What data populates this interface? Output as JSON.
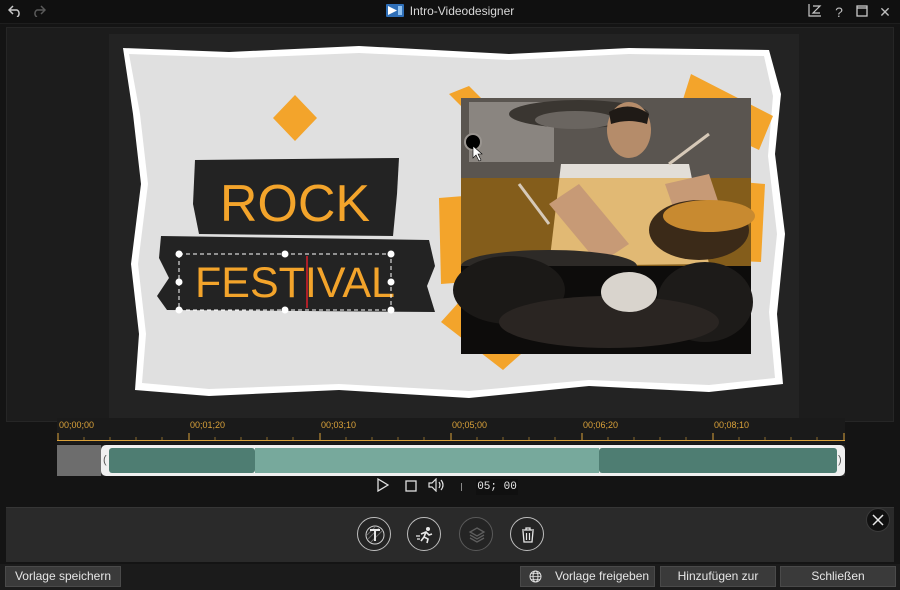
{
  "window": {
    "title": "Intro-Videodesigner",
    "undo_icon": "undo-icon",
    "redo_icon": "redo-icon",
    "controls": [
      "resize-icon",
      "help-icon",
      "maximize-icon",
      "close-icon"
    ],
    "help_glyph": "?",
    "close_glyph": "✕"
  },
  "canvas": {
    "title_line1": "ROCK",
    "title_line2": "FESTIVAL",
    "colors": {
      "accent": "#f3a42b",
      "paper": "#e0e0e0",
      "band": "#232323",
      "photo_tint": "#e09a22"
    }
  },
  "timeline": {
    "ticks": [
      "00;00;00",
      "00;01;20",
      "00;03;10",
      "00;05;00",
      "00;06;20",
      "00;08;10"
    ],
    "left_handle": "(",
    "right_handle": ")",
    "colors": {
      "clip_dark": "#4e7d72",
      "clip_light": "#77a99c",
      "ruler": "#d9a13a"
    }
  },
  "transport": {
    "play_icon": "play-icon",
    "stop_icon": "stop-icon",
    "volume_icon": "volume-icon",
    "timecode": "05; 00"
  },
  "tools": [
    {
      "icon": "text-tool-icon",
      "enabled": true
    },
    {
      "icon": "motion-tool-icon",
      "enabled": true
    },
    {
      "icon": "layers-tool-icon",
      "enabled": false
    },
    {
      "icon": "delete-icon",
      "enabled": true
    }
  ],
  "footer": {
    "save_template": "Vorlage speichern",
    "share_template": "Vorlage freigeben",
    "add_to_timeline": "Hinzufügen zur Zeit...",
    "close": "Schließen"
  }
}
